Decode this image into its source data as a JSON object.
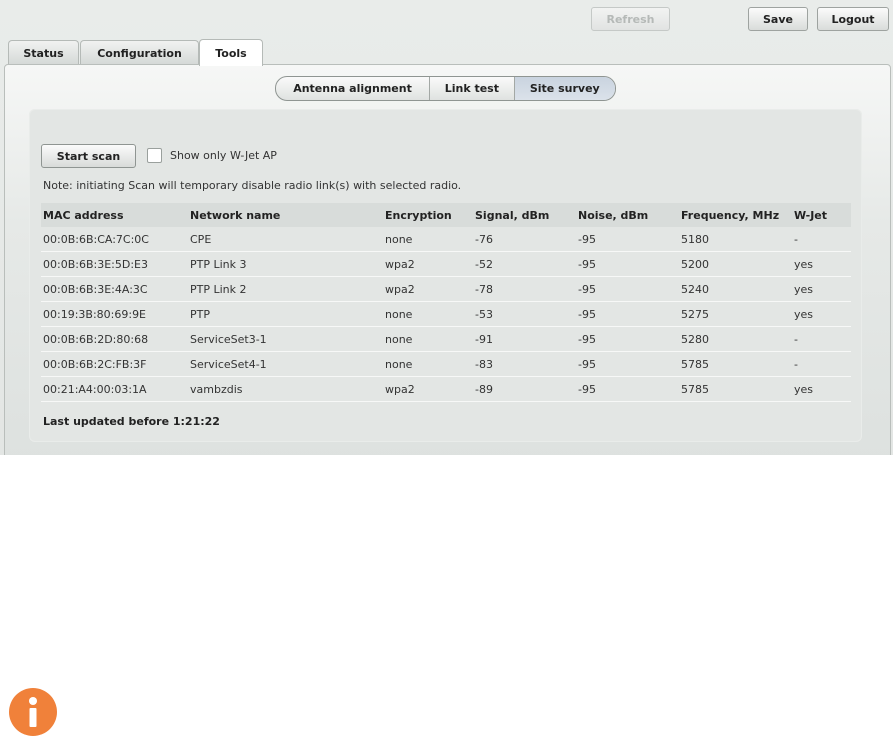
{
  "toolbar": {
    "refresh_label": "Refresh",
    "save_label": "Save",
    "logout_label": "Logout"
  },
  "tabs": [
    {
      "label": "Status"
    },
    {
      "label": "Configuration"
    },
    {
      "label": "Tools",
      "active": true
    }
  ],
  "subtabs": [
    {
      "label": "Antenna alignment"
    },
    {
      "label": "Link test"
    },
    {
      "label": "Site survey",
      "active": true
    }
  ],
  "survey": {
    "scan_button": "Start scan",
    "checkbox_label": "Show only W-Jet AP",
    "checkbox_checked": false,
    "note": "Note: initiating Scan will temporary disable radio link(s) with selected radio.",
    "columns": [
      "MAC address",
      "Network name",
      "Encryption",
      "Signal, dBm",
      "Noise, dBm",
      "Frequency, MHz",
      "W-Jet"
    ],
    "rows": [
      [
        "00:0B:6B:CA:7C:0C",
        "CPE",
        "none",
        "-76",
        "-95",
        "5180",
        "-"
      ],
      [
        "00:0B:6B:3E:5D:E3",
        "PTP Link 3",
        "wpa2",
        "-52",
        "-95",
        "5200",
        "yes"
      ],
      [
        "00:0B:6B:3E:4A:3C",
        "PTP Link 2",
        "wpa2",
        "-78",
        "-95",
        "5240",
        "yes"
      ],
      [
        "00:19:3B:80:69:9E",
        "PTP",
        "none",
        "-53",
        "-95",
        "5275",
        "yes"
      ],
      [
        "00:0B:6B:2D:80:68",
        "ServiceSet3-1",
        "none",
        "-91",
        "-95",
        "5280",
        "-"
      ],
      [
        "00:0B:6B:2C:FB:3F",
        "ServiceSet4-1",
        "none",
        "-83",
        "-95",
        "5785",
        "-"
      ],
      [
        "00:21:A4:00:03:1A",
        "vambzdis",
        "wpa2",
        "-89",
        "-95",
        "5785",
        "yes"
      ]
    ],
    "last_updated": "Last updated before 1:21:22"
  },
  "icons": {
    "info": "info-icon"
  },
  "colors": {
    "info_icon": "#f0813a",
    "active_subtab": "#cfd8e3"
  }
}
